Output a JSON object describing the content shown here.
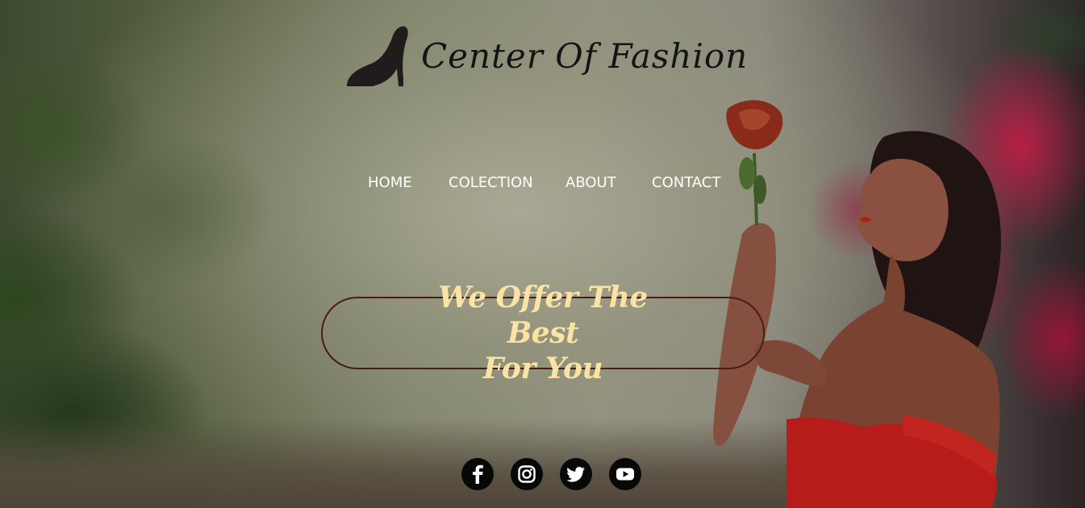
{
  "brand": {
    "name": "Center Of Fashion",
    "logo_icon": "high-heel-shoe-icon"
  },
  "nav": {
    "items": [
      {
        "label": "HOME"
      },
      {
        "label": "COLECTION"
      },
      {
        "label": "ABOUT"
      },
      {
        "label": "CONTACT"
      }
    ]
  },
  "hero": {
    "line1": "We Offer The Best",
    "line2": "For You"
  },
  "socials": [
    {
      "icon": "facebook-icon"
    },
    {
      "icon": "instagram-icon"
    },
    {
      "icon": "twitter-icon"
    },
    {
      "icon": "youtube-icon"
    }
  ],
  "colors": {
    "nav_text": "#ffffff",
    "hero_text": "#fbe3a6",
    "hero_border": "#4b1c14",
    "logo_text": "#141414",
    "social_bg": "#080808"
  }
}
